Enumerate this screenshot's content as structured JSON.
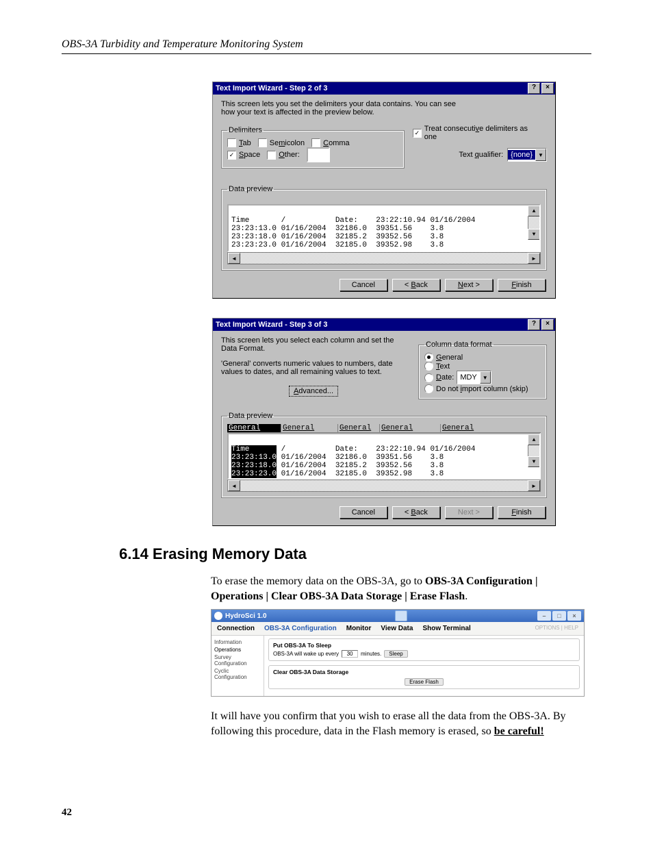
{
  "running_head": "OBS-3A Turbidity and Temperature Monitoring System",
  "page_number": "42",
  "dlg1": {
    "title": "Text Import Wizard - Step 2 of 3",
    "desc": "This screen lets you set the delimiters your data contains.  You can see how your text is affected in the preview below.",
    "delimiters_legend": "Delimiters",
    "tab": "Tab",
    "semicolon": "Semicolon",
    "comma": "Comma",
    "space": "Space",
    "other": "Other:",
    "treat_consec": "Treat consecutive delimiters as one",
    "text_qualifier_label": "Text qualifier:",
    "text_qualifier_value": "{none}",
    "data_preview_legend": "Data preview",
    "buttons": {
      "cancel": "Cancel",
      "back": "< Back",
      "next": "Next >",
      "finish": "Finish"
    }
  },
  "dlg2": {
    "title": "Text Import Wizard - Step 3 of 3",
    "desc1": "This screen lets you select each column and set the Data Format.",
    "desc2": "'General' converts numeric values to numbers, date values to dates, and all remaining values to text.",
    "advanced": "Advanced...",
    "col_format_legend": "Column data format",
    "general": "General",
    "text": "Text",
    "date": "Date:",
    "date_val": "MDY",
    "skip": "Do not import column (skip)",
    "data_preview_legend": "Data preview",
    "col_header": "General",
    "buttons": {
      "cancel": "Cancel",
      "back": "< Back",
      "next": "Next >",
      "finish": "Finish"
    }
  },
  "preview": {
    "line1": "Time       /           Date:    23:22:10.94 01/16/2004",
    "line2": "23:23:13.0 01/16/2004  32186.0  39351.56    3.8",
    "line3": "23:23:18.0 01/16/2004  32185.2  39352.56    3.8",
    "line4": "23:23:23.0 01/16/2004  32185.0  39352.98    3.8"
  },
  "section": {
    "heading": "6.14  Erasing Memory Data",
    "p1a": "To erase the memory data on the OBS-3A, go to ",
    "p1b": "OBS-3A Configuration | Operations | Clear OBS-3A Data Storage | Erase Flash",
    "p1c": ".",
    "p2a": "It will have you confirm that you wish to erase all the data from the OBS-3A. By following this procedure, data in the Flash memory is erased, so ",
    "p2b": "be careful!"
  },
  "hydro": {
    "title": "HydroSci 1.0",
    "menu": [
      "Connection",
      "OBS-3A Configuration",
      "Monitor",
      "View Data",
      "Show Terminal"
    ],
    "menu_right": "OPTIONS | HELP",
    "side": [
      "Information",
      "Operations",
      "Survey Configuration",
      "Cyclic Configuration"
    ],
    "fs1_label": "Put OBS-3A To Sleep",
    "fs1_text_a": "OBS-3A will wake up every",
    "fs1_text_val": "30",
    "fs1_text_b": "minutes.",
    "fs1_btn": "Sleep",
    "fs2_label": "Clear OBS-3A Data Storage",
    "fs2_btn": "Erase Flash"
  },
  "icons": {
    "help": "?",
    "close": "×",
    "down": "▼",
    "left": "◄",
    "right": "►",
    "up": "▲",
    "min": "–",
    "max": "□"
  }
}
